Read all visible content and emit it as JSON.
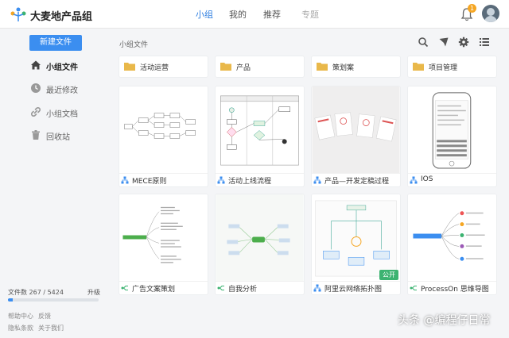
{
  "header": {
    "brand": "大麦地产品组",
    "nav": [
      "小组",
      "我的",
      "推荐",
      "专题"
    ],
    "active_nav": "小组",
    "notification_count": "1"
  },
  "sidebar": {
    "new_file": "新建文件",
    "items": [
      {
        "label": "小组文件",
        "icon": "home-icon",
        "active": true
      },
      {
        "label": "最近修改",
        "icon": "clock-icon",
        "active": false
      },
      {
        "label": "小组文档",
        "icon": "link-icon",
        "active": false
      },
      {
        "label": "回收站",
        "icon": "trash-icon",
        "active": false
      }
    ],
    "storage_text": "文件数 267 / 5424",
    "storage_fraction": 0.049,
    "upgrade": "升级",
    "links": [
      "帮助中心",
      "反馈",
      "隐私条款",
      "关于我们"
    ]
  },
  "main": {
    "breadcrumb": "小组文件",
    "toolbar_icons": [
      "search-icon",
      "send-icon",
      "settings-icon",
      "list-view-icon"
    ],
    "folders": [
      "活动运营",
      "产品",
      "策划案",
      "项目管理"
    ],
    "files": [
      {
        "title": "MECE原则",
        "type": "flowchart"
      },
      {
        "title": "活动上线流程",
        "type": "flowchart"
      },
      {
        "title": "产品—开发定稿过程",
        "type": "flowchart"
      },
      {
        "title": "IOS",
        "type": "flowchart"
      },
      {
        "title": "广告文案策划",
        "type": "mindmap"
      },
      {
        "title": "自我分析",
        "type": "mindmap"
      },
      {
        "title": "阿里云网络拓扑图",
        "type": "flowchart",
        "badge": "公开"
      },
      {
        "title": "ProcessOn 思维导图",
        "type": "mindmap"
      }
    ]
  },
  "watermark": "头条 @编程仔日常",
  "colors": {
    "accent": "#3b8ef0",
    "folder": "#e9b84a",
    "public_badge": "#3cb371",
    "notification": "#f5a623"
  }
}
